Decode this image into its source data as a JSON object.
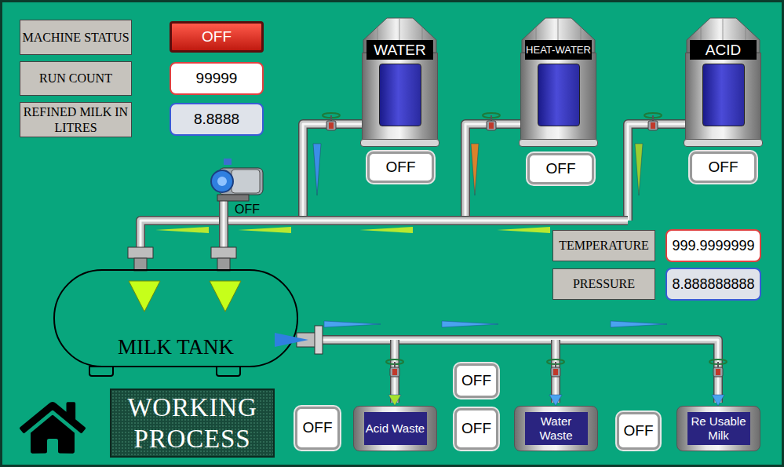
{
  "machine_status": {
    "label": "MACHINE STATUS",
    "value": "OFF",
    "on": false
  },
  "counters": [
    {
      "label": "RUN COUNT",
      "value": "99999"
    },
    {
      "label": "REFINED MILK IN LITRES",
      "value": "8.8888"
    }
  ],
  "silos": [
    {
      "name": "WATER",
      "state": "OFF",
      "on": false,
      "color": "#3b8ee8"
    },
    {
      "name": "HEAT-WATER",
      "state": "OFF",
      "on": false,
      "color": "#d9822b"
    },
    {
      "name": "ACID",
      "state": "OFF",
      "on": false,
      "color": "#9acd32"
    }
  ],
  "pump": {
    "state": "OFF",
    "on": false
  },
  "tank": {
    "label": "MILK TANK"
  },
  "readings": [
    {
      "label": "TEMPERATURE",
      "value": "999.9999999"
    },
    {
      "label": "PRESSURE",
      "value": "8.888888888"
    }
  ],
  "outlets": [
    {
      "name": "Acid Waste",
      "state": "OFF",
      "on": false,
      "color": "#a6e22e"
    },
    {
      "name": "Water Waste",
      "state": "OFF",
      "on": false,
      "color": "#4aa3f0"
    },
    {
      "name": "Re Usable Milk",
      "state": "OFF",
      "on": false,
      "color": "#4aa3f0"
    }
  ],
  "extra_switch": {
    "state": "OFF",
    "on": false
  },
  "title": "WORKING PROCESS"
}
